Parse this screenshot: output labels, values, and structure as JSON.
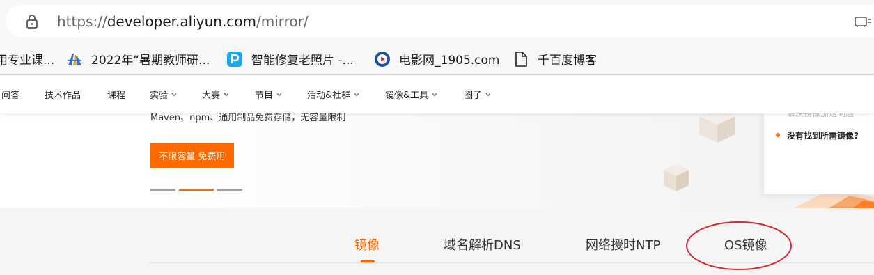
{
  "browser": {
    "url_scheme": "https://",
    "url_host": "developer.aliyun.com",
    "url_path": "/mirror/"
  },
  "bookmarks": [
    {
      "label": "用专业课...",
      "icon": "none"
    },
    {
      "label": "2022年“暑期教师研...",
      "icon": "building-logo-icon"
    },
    {
      "label": "智能修复老照片 -...",
      "icon": "p-app-icon"
    },
    {
      "label": "电影网_1905.com",
      "icon": "play-circle-icon"
    },
    {
      "label": "千百度博客",
      "icon": "document-icon"
    }
  ],
  "nav": {
    "items": [
      {
        "label": "问答",
        "has_dropdown": false
      },
      {
        "label": "技术作品",
        "has_dropdown": false
      },
      {
        "label": "课程",
        "has_dropdown": false
      },
      {
        "label": "实验",
        "has_dropdown": true
      },
      {
        "label": "大赛",
        "has_dropdown": true
      },
      {
        "label": "节目",
        "has_dropdown": true
      },
      {
        "label": "活动&社群",
        "has_dropdown": true
      },
      {
        "label": "镜像&工具",
        "has_dropdown": true
      },
      {
        "label": "圈子",
        "has_dropdown": true
      }
    ]
  },
  "banner": {
    "subtitle": "Maven、npm、通用制品免费存储，无容量限制",
    "cta_label": "不限容量 免费用",
    "carousel_active_index": 1,
    "side_faded_text": "解决镜像加速问题",
    "side_link": "没有找到所需镜像?"
  },
  "tabs": {
    "items": [
      "镜像",
      "域名解析DNS",
      "网络授时NTP",
      "OS镜像"
    ],
    "active": "镜像"
  },
  "colors": {
    "accent": "#ff6a00",
    "annotation_circle": "#d9282f"
  }
}
